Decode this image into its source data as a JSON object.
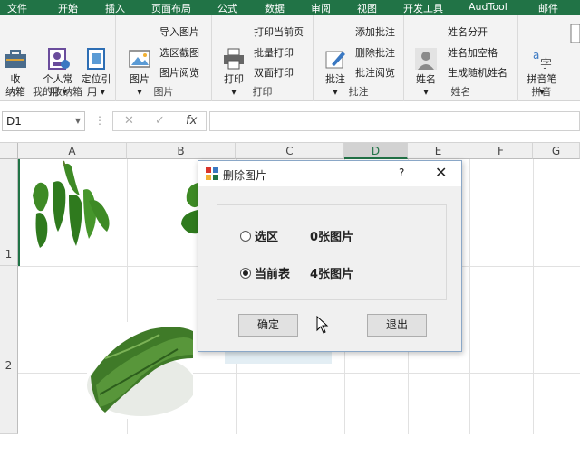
{
  "tabs": [
    "文件",
    "开始",
    "插入",
    "页面布局",
    "公式",
    "数据",
    "审阅",
    "视图",
    "开发工具",
    "AudTool",
    "邮件"
  ],
  "ribbon": {
    "groups": {
      "storage": {
        "label": "我的收纳箱",
        "buttons": [
          "收\n纳箱",
          "个人常\n用 ▾",
          "定位引\n用 ▾"
        ]
      },
      "picture": {
        "label": "图片",
        "big": "图片\n▾",
        "small": [
          "导入图片",
          "选区截图",
          "图片阅览"
        ]
      },
      "print": {
        "label": "打印",
        "big": "打印\n▾",
        "small": [
          "打印当前页",
          "批量打印",
          "双面打印"
        ]
      },
      "comment": {
        "label": "批注",
        "big": "批注\n▾",
        "small": [
          "添加批注",
          "删除批注",
          "批注阅览"
        ]
      },
      "name": {
        "label": "姓名",
        "big": "姓名\n▾",
        "small": [
          "姓名分开",
          "姓名加空格",
          "生成随机姓名"
        ]
      },
      "pinyin": {
        "label": "拼音",
        "big": "拼音笔\n▾"
      }
    }
  },
  "formula_bar": {
    "name_box": "D1",
    "cancel": "✕",
    "enter": "✓",
    "fx": "fx",
    "content": ""
  },
  "grid": {
    "columns": [
      "A",
      "B",
      "C",
      "D",
      "E",
      "F",
      "G"
    ],
    "rows": [
      "1",
      "2"
    ],
    "selected_column": "D"
  },
  "dialog": {
    "title": "删除图片",
    "help": "?",
    "close": "✕",
    "options": [
      {
        "label": "选区",
        "count": "0张图片",
        "selected": false
      },
      {
        "label": "当前表",
        "count": "4张图片",
        "selected": true
      }
    ],
    "ok": "确定",
    "exit": "退出"
  },
  "colors": {
    "accent": "#217346",
    "ribbon_bg": "#f3f3f3",
    "dialog_bg": "#f0f0f0"
  }
}
